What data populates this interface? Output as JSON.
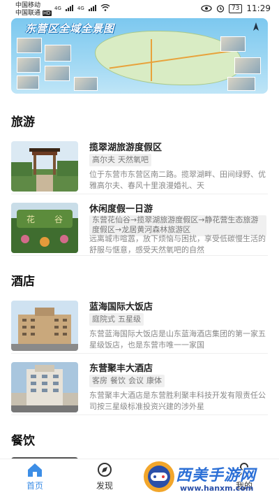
{
  "status_bar": {
    "carrier1": "中国移动",
    "carrier2": "中国联通",
    "hd_badge": "HD",
    "net1": "4G",
    "net2": "4G",
    "battery": "73",
    "time": "11:29"
  },
  "banner": {
    "title": "东营区全域全景图"
  },
  "sections": {
    "travel": {
      "title": "旅游",
      "items": [
        {
          "title": "揽翠湖旅游度假区",
          "tags": [
            "高尔夫",
            "天然氧吧"
          ],
          "desc": "位于东营市东营区南二路。揽翠湖畔、田间绿野、优雅高尔夫、春风十里浪漫婚礼、天"
        },
        {
          "title": "休闲度假一日游",
          "tags": [
            "东营花仙谷→揽翠湖旅游度假区→静花营生态旅游度假区→龙居黄河森林旅游区"
          ],
          "desc": "远离城市喧嚣，放下烦恼与困扰，享受低碳慢生活的舒服与惬意，感受天然氧吧的自然"
        }
      ]
    },
    "hotel": {
      "title": "酒店",
      "items": [
        {
          "title": "蓝海国际大饭店",
          "tags": [
            "庭院式",
            "五星级"
          ],
          "desc": "东营蓝海国际大饭店是山东蓝海酒店集团的第一家五星级饭店，也是东营市唯一一家国"
        },
        {
          "title": "东营聚丰大酒店",
          "tags": [
            "客房",
            "餐饮",
            "会议",
            "康体"
          ],
          "desc": "东营聚丰大酒店是东营胜利聚丰科技开发有限责任公司按三星级标准投资兴建的涉外星"
        }
      ]
    },
    "food": {
      "title": "餐饮"
    }
  },
  "bottom_nav": {
    "home": "首页",
    "discover": "发现",
    "mine": "我的"
  },
  "watermark": {
    "brand": "西美手游网",
    "url": "www.hanxm.com"
  },
  "colors": {
    "accent": "#3d8ee6",
    "banner_sky": "#7cc8ef"
  }
}
